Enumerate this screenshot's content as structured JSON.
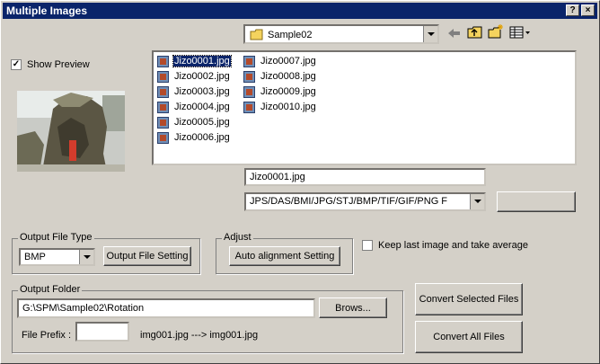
{
  "window": {
    "title": "Multiple Images",
    "help_btn": "?",
    "close_btn": "×"
  },
  "folder_combo": {
    "value": "Sample02"
  },
  "toolbar": {
    "back_icon": "back-arrow-icon",
    "up_icon": "up-folder-icon",
    "new_icon": "new-folder-icon",
    "view_icon": "view-menu-icon"
  },
  "preview": {
    "show_label": "Show Preview",
    "checked": true
  },
  "files": [
    {
      "name": "Jizo0001.jpg",
      "selected": true
    },
    {
      "name": "Jizo0002.jpg"
    },
    {
      "name": "Jizo0003.jpg"
    },
    {
      "name": "Jizo0004.jpg"
    },
    {
      "name": "Jizo0005.jpg"
    },
    {
      "name": "Jizo0006.jpg"
    },
    {
      "name": "Jizo0007.jpg"
    },
    {
      "name": "Jizo0008.jpg"
    },
    {
      "name": "Jizo0009.jpg"
    },
    {
      "name": "Jizo0010.jpg"
    }
  ],
  "filename_field": {
    "value": "Jizo0001.jpg"
  },
  "filetype_filter": {
    "value": "JPS/DAS/BMI/JPG/STJ/BMP/TIF/GIF/PNG F"
  },
  "output_file_type": {
    "legend": "Output File Type",
    "value": "BMP",
    "setting_button": "Output File Setting"
  },
  "adjust": {
    "legend": "Adjust",
    "button": "Auto alignment Setting"
  },
  "keep_last": {
    "label": "Keep last image and take average",
    "checked": false
  },
  "output_folder": {
    "legend": "Output Folder",
    "path": "G:\\SPM\\Sample02\\Rotation",
    "browse_button": "Brows...",
    "prefix_label": "File Prefix :",
    "prefix_value": "",
    "example": "img001.jpg ---> img001.jpg"
  },
  "actions": {
    "convert_selected": "Convert Selected Files",
    "convert_all": "Convert All Files"
  }
}
